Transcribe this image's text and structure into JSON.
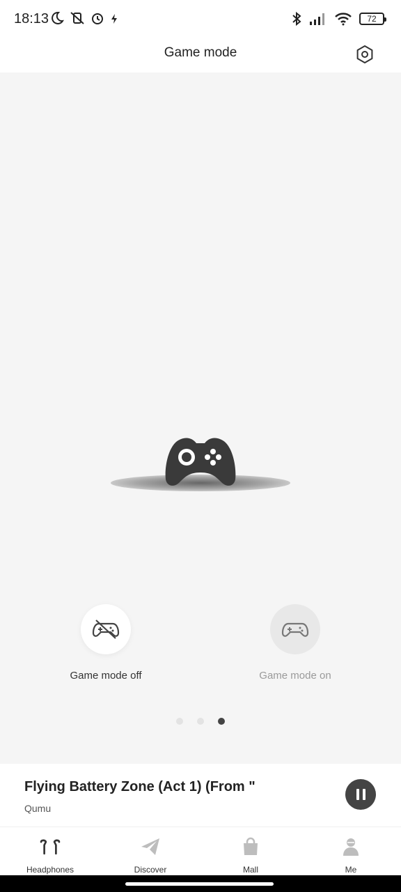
{
  "status_bar": {
    "time": "18:13",
    "battery": "72",
    "left_icons": [
      "moon-icon",
      "vibrate-off-icon",
      "alarm-icon",
      "flash-icon"
    ],
    "right_icons": [
      "bluetooth-icon",
      "signal-icon",
      "wifi-icon",
      "battery-icon"
    ]
  },
  "header": {
    "title": "Game mode",
    "settings_icon": "settings-hexagon-icon"
  },
  "modes": {
    "off_label": "Game mode off",
    "on_label": "Game mode on",
    "selected": "off"
  },
  "pager": {
    "count": 3,
    "active_index": 2
  },
  "now_playing": {
    "title": "Flying Battery Zone (Act 1) (From \"",
    "artist": "Qumu",
    "state_icon": "pause-icon"
  },
  "bottom_nav": {
    "items": [
      {
        "label": "Headphones",
        "icon": "earbuds-icon",
        "active": true
      },
      {
        "label": "Discover",
        "icon": "paper-plane-icon",
        "active": false
      },
      {
        "label": "Mall",
        "icon": "shopping-bag-icon",
        "active": false
      },
      {
        "label": "Me",
        "icon": "person-icon",
        "active": false
      }
    ]
  },
  "colors": {
    "background": "#f5f5f5",
    "dark": "#444444",
    "inactive_icon": "#bdbdbd"
  }
}
